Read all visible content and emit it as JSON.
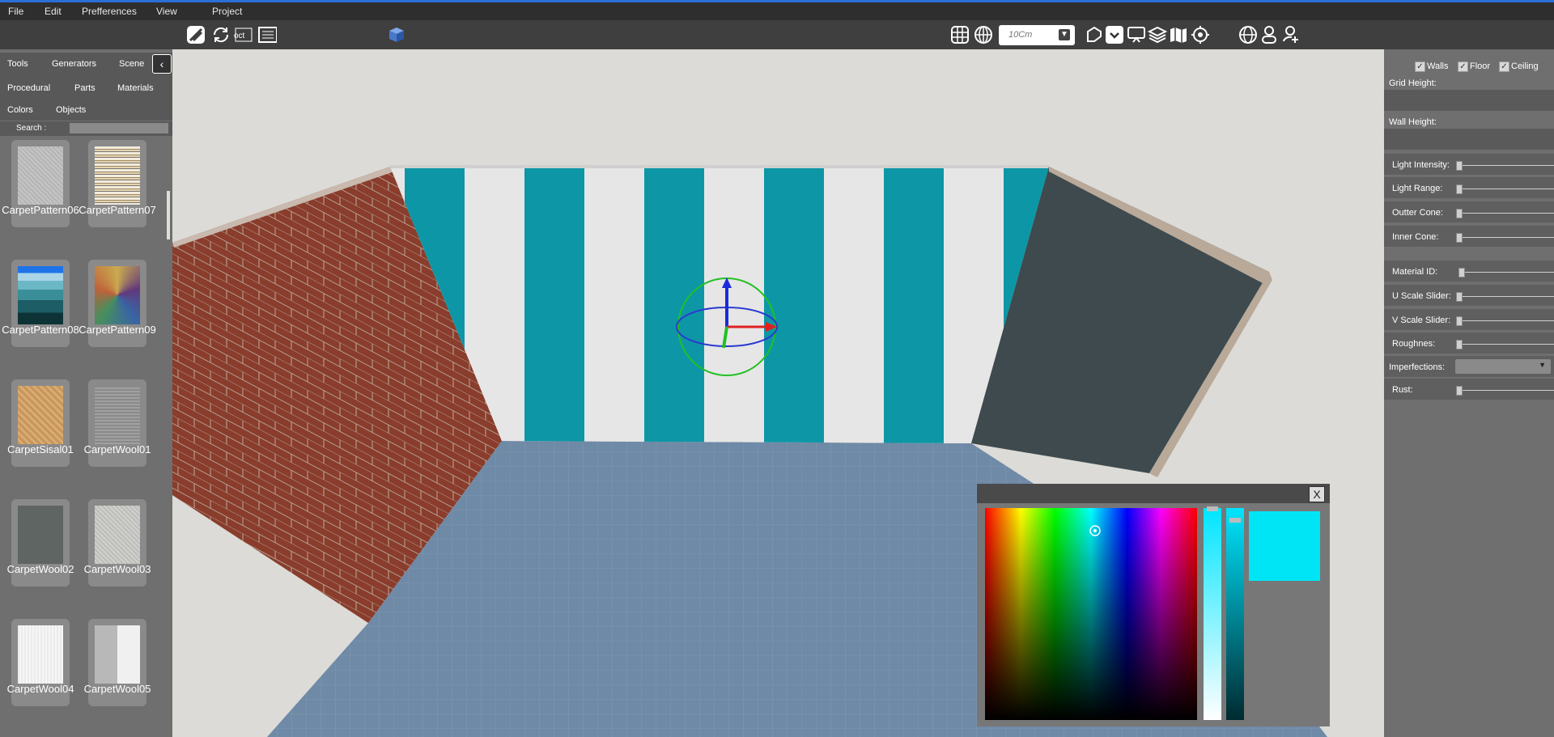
{
  "menu": [
    "File",
    "Edit",
    "Prefferences",
    "View",
    "Project"
  ],
  "toolbar": {
    "unit_value": "10Cm",
    "icons": [
      "logo-icon",
      "refresh-icon",
      "octagon-icon",
      "scene-icon",
      "cube-icon",
      "grid-icon",
      "globe-grid-icon",
      "shape-icon",
      "checkbox-toggle-icon",
      "monitor-icon",
      "layers-icon",
      "map-icon",
      "target-icon",
      "globe-icon",
      "person-icon",
      "user-sync-icon"
    ]
  },
  "left": {
    "tabs_row1": [
      "Tools",
      "Generators",
      "Scene"
    ],
    "tabs_row2": [
      "Procedural",
      "Parts",
      "Materials"
    ],
    "tabs_row3": [
      "Colors",
      "Objects"
    ],
    "search_label": "Search :",
    "materials": [
      {
        "name": "CarpetPattern06",
        "color": "#b8b8b8"
      },
      {
        "name": "CarpetPattern07",
        "color": "#d8cdb8"
      },
      {
        "name": "CarpetPattern08",
        "color": "#3aa0c0"
      },
      {
        "name": "CarpetPattern09",
        "color": "#444444"
      },
      {
        "name": "CarpetSisal01",
        "color": "#c89a60"
      },
      {
        "name": "CarpetWool01",
        "color": "#8e8e8e"
      },
      {
        "name": "CarpetWool02",
        "color": "#5e625f"
      },
      {
        "name": "CarpetWool03",
        "color": "#c4c4c2"
      },
      {
        "name": "CarpetWool04",
        "color": "#ececec"
      },
      {
        "name": "CarpetWool05",
        "color": "#bdbdbd"
      }
    ]
  },
  "right": {
    "checks": [
      {
        "label": "Walls",
        "checked": true
      },
      {
        "label": "Floor",
        "checked": true
      },
      {
        "label": "Ceiling",
        "checked": true
      }
    ],
    "grid_height": "Grid Height:",
    "wall_height": "Wall Height:",
    "light": [
      "Light Intensity:",
      "Light Range:",
      "Outter Cone:",
      "Inner Cone:"
    ],
    "material": [
      "Material ID:",
      "U Scale Slider:",
      "V Scale Slider:",
      "Roughnes:"
    ],
    "imperfections": "Imperfections:",
    "rust": "Rust:"
  },
  "picker": {
    "close_label": "X",
    "selected_color": "#00e5f5"
  }
}
